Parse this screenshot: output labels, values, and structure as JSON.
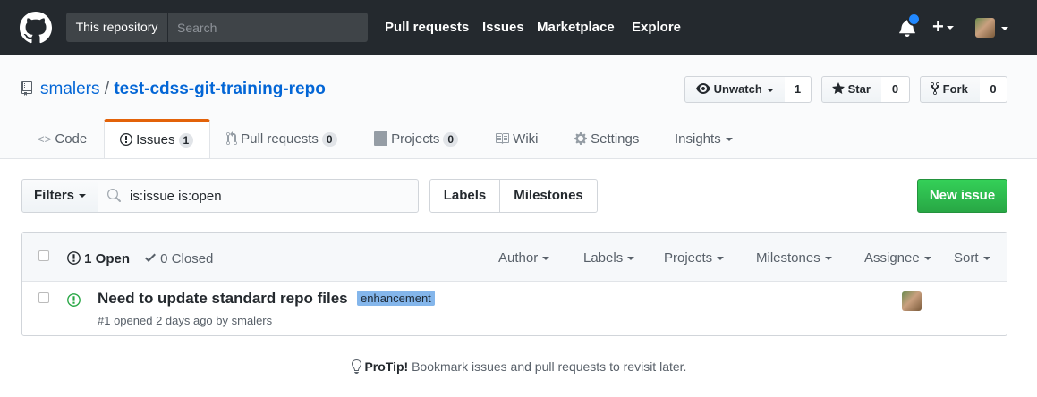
{
  "header": {
    "scope_label": "This repository",
    "search_placeholder": "Search",
    "nav": [
      "Pull requests",
      "Issues",
      "Marketplace",
      "Explore"
    ],
    "plus": "+"
  },
  "repo": {
    "owner": "smalers",
    "separator": "/",
    "name": "test-cdss-git-training-repo",
    "unwatch_label": "Unwatch",
    "watch_count": "1",
    "star_label": "Star",
    "star_count": "0",
    "fork_label": "Fork",
    "fork_count": "0"
  },
  "tabs": [
    {
      "label": "Code"
    },
    {
      "label": "Issues",
      "counter": "1"
    },
    {
      "label": "Pull requests",
      "counter": "0"
    },
    {
      "label": "Projects",
      "counter": "0"
    },
    {
      "label": "Wiki"
    },
    {
      "label": "Settings"
    },
    {
      "label": "Insights"
    }
  ],
  "filterbar": {
    "filters_label": "Filters",
    "query": "is:issue is:open",
    "labels_label": "Labels",
    "milestones_label": "Milestones",
    "new_issue_label": "New issue"
  },
  "issues_header": {
    "open_label": "1 Open",
    "closed_label": "0 Closed",
    "filters": [
      "Author",
      "Labels",
      "Projects",
      "Milestones",
      "Assignee",
      "Sort"
    ]
  },
  "issues": [
    {
      "title": "Need to update standard repo files",
      "label": "enhancement",
      "meta": "#1 opened 2 days ago by smalers"
    }
  ],
  "protip": {
    "bold": "ProTip!",
    "text": " Bookmark issues and pull requests to revisit later."
  },
  "colors": {
    "header_bg": "#24292e",
    "accent_orange": "#e36209",
    "new_issue_green": "#28a745",
    "label_enhancement": "#84b6eb",
    "link_blue": "#0366d6"
  }
}
